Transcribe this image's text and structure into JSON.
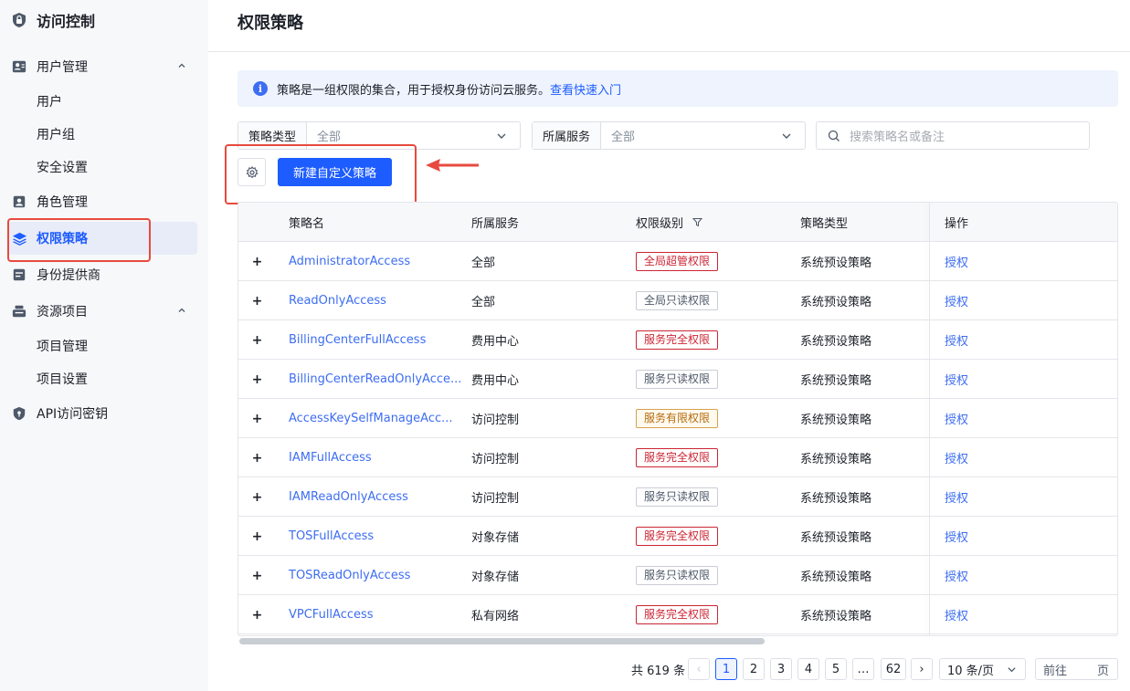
{
  "sidebar": {
    "title": "访问控制",
    "groups": [
      {
        "label": "用户管理",
        "children": [
          "用户",
          "用户组",
          "安全设置"
        ]
      },
      {
        "label": "角色管理"
      },
      {
        "label": "权限策略"
      },
      {
        "label": "身份提供商"
      },
      {
        "label": "资源项目",
        "children": [
          "项目管理",
          "项目设置"
        ]
      },
      {
        "label": "API访问密钥"
      }
    ]
  },
  "header": {
    "title": "权限策略"
  },
  "info_bar": {
    "icon": "info-icon",
    "text": "策略是一组权限的集合，用于授权身份访问云服务。",
    "link": "查看快速入门"
  },
  "filters": {
    "policy_type": {
      "label": "策略类型",
      "value": "全部"
    },
    "service": {
      "label": "所属服务",
      "value": "全部"
    },
    "search": {
      "placeholder": "搜索策略名或备注"
    }
  },
  "toolbar": {
    "create_button": "新建自定义策略"
  },
  "table": {
    "columns": [
      "策略名",
      "所属服务",
      "权限级别",
      "策略类型",
      "操作"
    ],
    "rows": [
      {
        "name": "AdministratorAccess",
        "service": "全部",
        "level": "全局超管权限",
        "level_style": "red",
        "type": "系统预设策略",
        "action": "授权"
      },
      {
        "name": "ReadOnlyAccess",
        "service": "全部",
        "level": "全局只读权限",
        "level_style": "gray",
        "type": "系统预设策略",
        "action": "授权"
      },
      {
        "name": "BillingCenterFullAccess",
        "service": "费用中心",
        "level": "服务完全权限",
        "level_style": "red",
        "type": "系统预设策略",
        "action": "授权"
      },
      {
        "name": "BillingCenterReadOnlyAcce...",
        "service": "费用中心",
        "level": "服务只读权限",
        "level_style": "gray",
        "type": "系统预设策略",
        "action": "授权"
      },
      {
        "name": "AccessKeySelfManageAcc...",
        "service": "访问控制",
        "level": "服务有限权限",
        "level_style": "orange",
        "type": "系统预设策略",
        "action": "授权"
      },
      {
        "name": "IAMFullAccess",
        "service": "访问控制",
        "level": "服务完全权限",
        "level_style": "red",
        "type": "系统预设策略",
        "action": "授权"
      },
      {
        "name": "IAMReadOnlyAccess",
        "service": "访问控制",
        "level": "服务只读权限",
        "level_style": "gray",
        "type": "系统预设策略",
        "action": "授权"
      },
      {
        "name": "TOSFullAccess",
        "service": "对象存储",
        "level": "服务完全权限",
        "level_style": "red",
        "type": "系统预设策略",
        "action": "授权"
      },
      {
        "name": "TOSReadOnlyAccess",
        "service": "对象存储",
        "level": "服务只读权限",
        "level_style": "gray",
        "type": "系统预设策略",
        "action": "授权"
      },
      {
        "name": "VPCFullAccess",
        "service": "私有网络",
        "level": "服务完全权限",
        "level_style": "red",
        "type": "系统预设策略",
        "action": "授权"
      }
    ]
  },
  "pagination": {
    "total_text": "共 619 条",
    "prev": "‹",
    "pages": [
      "1",
      "2",
      "3",
      "4",
      "5",
      "…",
      "62"
    ],
    "current": "1",
    "next": "›",
    "page_size": "10 条/页",
    "goto_label": "前往",
    "goto_suffix": "页"
  },
  "colors": {
    "primary": "#1d5cff",
    "link": "#3d6df2",
    "danger_tag": "#cb2634",
    "warning_tag": "#b56a0a",
    "annotation": "#e84a3f"
  }
}
